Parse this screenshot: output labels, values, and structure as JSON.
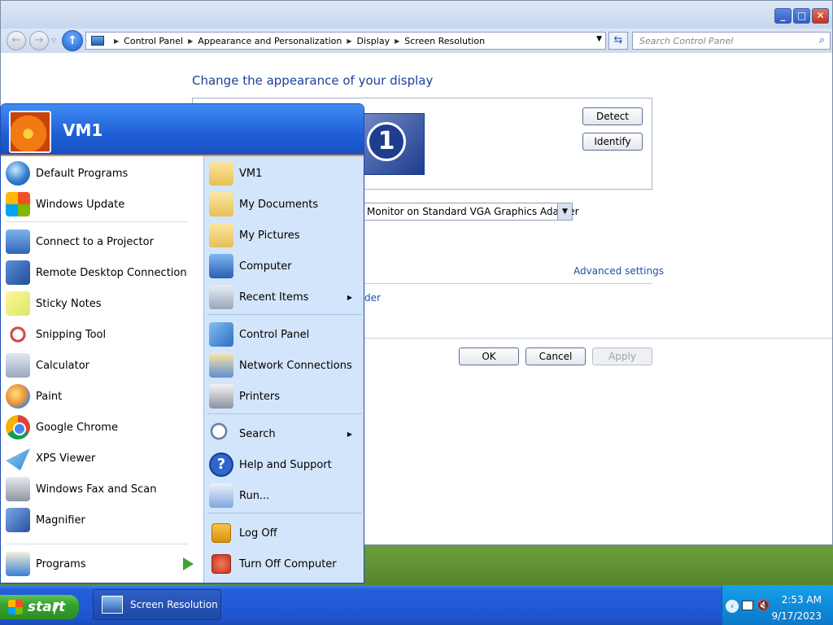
{
  "window": {
    "controls": {
      "minimize": "_",
      "maximize": "□",
      "close": "✕"
    },
    "breadcrumb": [
      "Control Panel",
      "Appearance and Personalization",
      "Display",
      "Screen Resolution"
    ],
    "search_placeholder": "Search Control Panel",
    "content": {
      "title": "Change the appearance of your display",
      "monitor_number": "1",
      "detect_label": "Detect",
      "identify_label": "Identify",
      "display_value": "Monitor on Standard VGA Graphics Adapter",
      "advanced_link": "Advanced settings",
      "partial_link": "der",
      "ok_label": "OK",
      "cancel_label": "Cancel",
      "apply_label": "Apply"
    }
  },
  "start_menu": {
    "user_name": "VM1",
    "left_items": [
      {
        "label": "Default Programs",
        "icon": "default-programs-icon"
      },
      {
        "label": "Windows Update",
        "icon": "windows-update-icon"
      },
      {
        "label": "Connect to a Projector",
        "icon": "projector-icon"
      },
      {
        "label": "Remote Desktop Connection",
        "icon": "remote-desktop-icon"
      },
      {
        "label": "Sticky Notes",
        "icon": "sticky-notes-icon"
      },
      {
        "label": "Snipping Tool",
        "icon": "snipping-tool-icon"
      },
      {
        "label": "Calculator",
        "icon": "calculator-icon"
      },
      {
        "label": "Paint",
        "icon": "paint-icon"
      },
      {
        "label": "Google Chrome",
        "icon": "chrome-icon"
      },
      {
        "label": "XPS Viewer",
        "icon": "xps-viewer-icon"
      },
      {
        "label": "Windows Fax and Scan",
        "icon": "fax-scan-icon"
      },
      {
        "label": "Magnifier",
        "icon": "magnifier-icon"
      }
    ],
    "programs_label": "Programs",
    "right_items": [
      {
        "label": "VM1",
        "icon": "user-folder-icon"
      },
      {
        "label": "My Documents",
        "icon": "documents-folder-icon"
      },
      {
        "label": "My Pictures",
        "icon": "pictures-folder-icon"
      },
      {
        "label": "Computer",
        "icon": "computer-icon"
      },
      {
        "label": "Recent Items",
        "icon": "recent-items-icon"
      },
      {
        "label": "Control Panel",
        "icon": "control-panel-icon"
      },
      {
        "label": "Network Connections",
        "icon": "network-connections-icon"
      },
      {
        "label": "Printers",
        "icon": "printers-icon"
      },
      {
        "label": "Search",
        "icon": "search-icon"
      },
      {
        "label": "Help and Support",
        "icon": "help-icon"
      },
      {
        "label": "Run...",
        "icon": "run-icon"
      },
      {
        "label": "Log Off",
        "icon": "log-off-icon"
      },
      {
        "label": "Turn Off Computer",
        "icon": "power-icon"
      }
    ]
  },
  "taskbar": {
    "start_label": "start",
    "task_label": "Screen Resolution",
    "time": "2:53 AM",
    "date": "9/17/2023"
  }
}
